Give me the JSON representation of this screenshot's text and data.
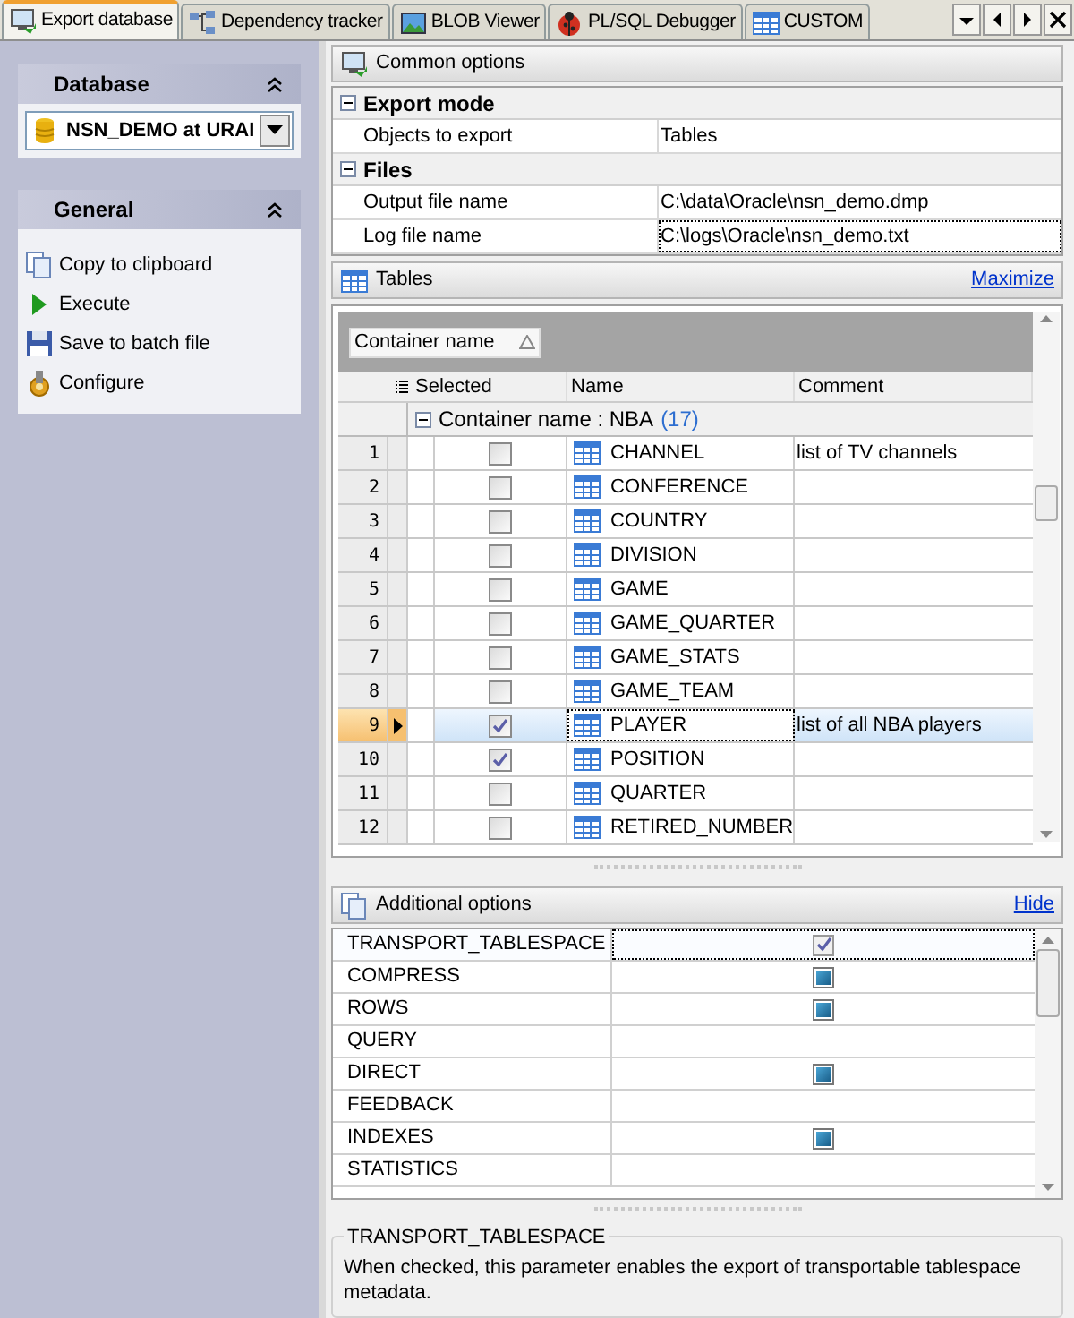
{
  "tabs": [
    {
      "label": "Export database",
      "selected": true
    },
    {
      "label": "Dependency tracker",
      "selected": false
    },
    {
      "label": "BLOB Viewer",
      "selected": false
    },
    {
      "label": "PL/SQL Debugger",
      "selected": false
    },
    {
      "label": "CUSTOM",
      "selected": false
    }
  ],
  "sidebar": {
    "database": {
      "title": "Database",
      "value": "NSN_DEMO at URAI"
    },
    "general": {
      "title": "General",
      "items": [
        {
          "label": "Copy to clipboard"
        },
        {
          "label": "Execute"
        },
        {
          "label": "Save to batch file"
        },
        {
          "label": "Configure"
        }
      ]
    }
  },
  "common_options": {
    "title": "Common options",
    "groups": [
      {
        "title": "Export mode",
        "expanded": true,
        "rows": [
          {
            "label": "Objects to export",
            "value": "Tables",
            "focused": false
          }
        ]
      },
      {
        "title": "Files",
        "expanded": true,
        "rows": [
          {
            "label": "Output file name",
            "value": "C:\\data\\Oracle\\nsn_demo.dmp",
            "focused": false
          },
          {
            "label": "Log file name",
            "value": "C:\\logs\\Oracle\\nsn_demo.txt",
            "focused": true
          }
        ]
      }
    ]
  },
  "tables": {
    "title": "Tables",
    "link": "Maximize",
    "group_by": "Container name",
    "columns": [
      "Selected",
      "Name",
      "Comment"
    ],
    "group": {
      "label": "Container name : NBA",
      "count": "(17)",
      "expanded": true
    },
    "rows": [
      {
        "number": "1",
        "checked": false,
        "name": "CHANNEL",
        "comment": "list of TV channels",
        "selected": false
      },
      {
        "number": "2",
        "checked": false,
        "name": "CONFERENCE",
        "selected": false
      },
      {
        "number": "3",
        "checked": false,
        "name": "COUNTRY",
        "selected": false
      },
      {
        "number": "4",
        "checked": false,
        "name": "DIVISION",
        "selected": false
      },
      {
        "number": "5",
        "checked": false,
        "name": "GAME",
        "selected": false
      },
      {
        "number": "6",
        "checked": false,
        "name": "GAME_QUARTER",
        "selected": false
      },
      {
        "number": "7",
        "checked": false,
        "name": "GAME_STATS",
        "selected": false
      },
      {
        "number": "8",
        "checked": false,
        "name": "GAME_TEAM",
        "selected": false
      },
      {
        "number": "9",
        "checked": true,
        "name": "PLAYER",
        "comment": "list of all NBA players",
        "selected": true
      },
      {
        "number": "10",
        "checked": true,
        "name": "POSITION",
        "selected": false
      },
      {
        "number": "11",
        "checked": false,
        "name": "QUARTER",
        "selected": false
      },
      {
        "number": "12",
        "checked": false,
        "name": "RETIRED_NUMBER",
        "selected": false
      }
    ]
  },
  "additional_options": {
    "title": "Additional options",
    "link": "Hide",
    "rows": [
      {
        "name": "TRANSPORT_TABLESPACE",
        "kind": "checkbox",
        "checked": true,
        "selected": true
      },
      {
        "name": "COMPRESS",
        "kind": "flag",
        "checked": true,
        "selected": false
      },
      {
        "name": "ROWS",
        "kind": "flag",
        "checked": true,
        "selected": false
      },
      {
        "name": "QUERY",
        "kind": "empty",
        "selected": false
      },
      {
        "name": "DIRECT",
        "kind": "flag",
        "checked": true,
        "selected": false
      },
      {
        "name": "FEEDBACK",
        "kind": "empty",
        "selected": false
      },
      {
        "name": "INDEXES",
        "kind": "flag",
        "checked": true,
        "selected": false
      },
      {
        "name": "STATISTICS",
        "kind": "empty",
        "selected": false
      }
    ]
  },
  "description": {
    "title": "TRANSPORT_TABLESPACE",
    "text": "When checked, this parameter enables the export of transportable tablespace metadata."
  }
}
